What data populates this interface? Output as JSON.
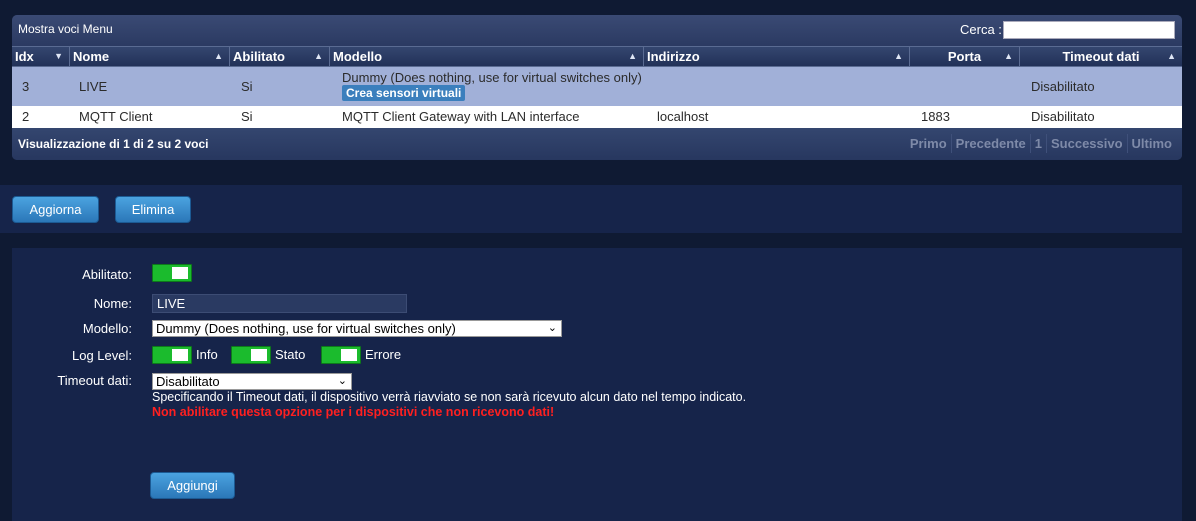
{
  "table": {
    "title": "Mostra voci Menu",
    "search_label": "Cerca :",
    "search_value": "",
    "columns": [
      "Idx",
      "Nome",
      "Abilitato",
      "Modello",
      "Indirizzo",
      "Porta",
      "Timeout dati"
    ],
    "rows": [
      {
        "idx": "3",
        "name": "LIVE",
        "enabled": "Si",
        "model": "Dummy (Does nothing, use for virtual switches only)",
        "model_button": "Crea sensori virtuali",
        "address": "",
        "port": "",
        "timeout": "Disabilitato"
      },
      {
        "idx": "2",
        "name": "MQTT Client",
        "enabled": "Si",
        "model": "MQTT Client Gateway with LAN interface",
        "address": "localhost",
        "port": "1883",
        "timeout": "Disabilitato"
      }
    ],
    "info": "Visualizzazione di 1 di 2 su 2 voci",
    "pager": [
      "Primo",
      "Precedente",
      "1",
      "Successivo",
      "Ultimo"
    ]
  },
  "actions": {
    "update_label": "Aggiorna",
    "delete_label": "Elimina"
  },
  "form": {
    "enabled_label": "Abilitato:",
    "enabled_value": true,
    "name_label": "Nome:",
    "name_value": "LIVE",
    "model_label": "Modello:",
    "model_value": "Dummy (Does nothing, use for virtual switches only)",
    "loglevel_label": "Log Level:",
    "log_info": "Info",
    "log_status": "Stato",
    "log_error": "Errore",
    "timeout_label": "Timeout dati:",
    "timeout_value": "Disabilitato",
    "hint": "Specificando il Timeout dati, il dispositivo verrà riavviato se non sarà ricevuto alcun dato nel tempo indicato.",
    "warning": "Non abilitare questa opzione per i dispositivi che non ricevono dati!",
    "add_label": "Aggiungi"
  },
  "colors": {
    "background": "#0f1a33",
    "selected_row": "#a1b0d8",
    "toggle_on": "#1bbb2d",
    "button": "#2b77b8",
    "warning": "#ff2020"
  }
}
